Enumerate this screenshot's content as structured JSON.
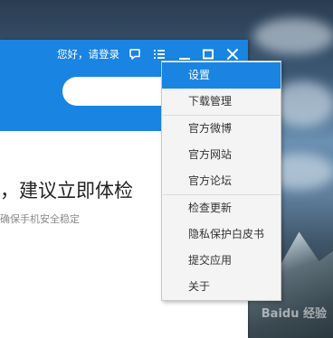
{
  "header": {
    "greeting": "您好，请登录"
  },
  "search": {
    "value": ""
  },
  "main": {
    "title": "，建议立即体检",
    "subtitle": "确保手机安全稳定"
  },
  "menu": {
    "items": [
      {
        "label": "设置",
        "active": true
      },
      {
        "label": "下载管理"
      },
      {
        "label": "官方微博"
      },
      {
        "label": "官方网站"
      },
      {
        "label": "官方论坛"
      },
      {
        "label": "检查更新"
      },
      {
        "label": "隐私保护白皮书"
      },
      {
        "label": "提交应用"
      },
      {
        "label": "关于"
      }
    ]
  },
  "colors": {
    "accent": "#1a84e2",
    "menu_bg": "#f4f4f4"
  },
  "icons": [
    "feedback-icon",
    "menu-list-icon",
    "minimize-icon",
    "maximize-icon",
    "close-icon"
  ]
}
